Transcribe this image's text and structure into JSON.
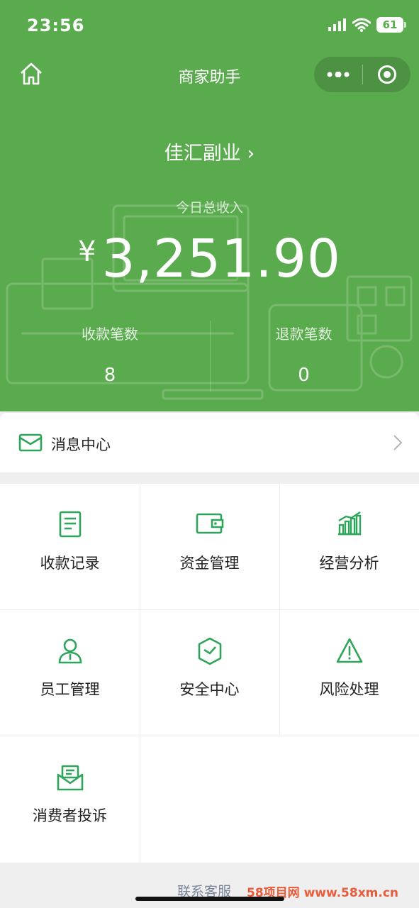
{
  "status_bar": {
    "time": "23:56",
    "battery": "61"
  },
  "nav": {
    "title": "商家助手"
  },
  "store": {
    "name": "佳汇副业 ›"
  },
  "income": {
    "label": "今日总收入",
    "currency": "¥",
    "amount": "3,251.90"
  },
  "stats": [
    {
      "label": "收款笔数",
      "value": "8"
    },
    {
      "label": "退款笔数",
      "value": "0"
    }
  ],
  "message_center": {
    "label": "消息中心"
  },
  "grid": [
    {
      "label": "收款记录",
      "icon": "receipt-icon"
    },
    {
      "label": "资金管理",
      "icon": "wallet-icon"
    },
    {
      "label": "经营分析",
      "icon": "bar-chart-icon"
    },
    {
      "label": "员工管理",
      "icon": "person-icon"
    },
    {
      "label": "安全中心",
      "icon": "shield-icon"
    },
    {
      "label": "风险处理",
      "icon": "warning-icon"
    },
    {
      "label": "消费者投诉",
      "icon": "complaint-mail-icon"
    }
  ],
  "footer": {
    "link": "联系客服",
    "watermark": "58项目网 www.58xm.cn"
  },
  "colors": {
    "brand": "#5aaa4e",
    "icon_green": "#2ea55a"
  }
}
